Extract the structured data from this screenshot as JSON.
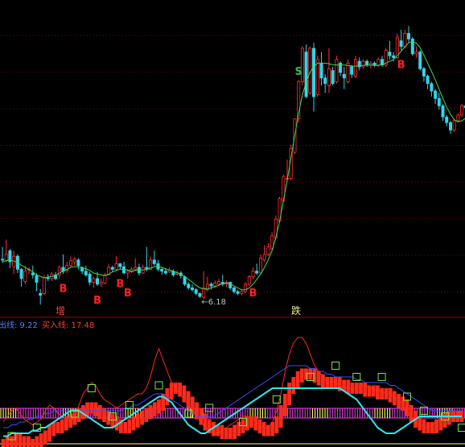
{
  "colors": {
    "background": "#000000",
    "grid": "#8b0000",
    "separator": "#b00000",
    "up_candle": "#ff3030",
    "down_candle": "#32d4e8",
    "ma_line": "#3cdc50",
    "signal_buy": "#ff2020",
    "signal_sell": "#2ec050",
    "low_label": "#c0c0c0",
    "indicator_red": "#ff2a1a",
    "indicator_cyan": "#2ee6ee",
    "indicator_blue": "#3a50ff",
    "indicator_square": "#7ee04a",
    "band_yellow": "#ffff66",
    "band_magenta": "#e040e0",
    "legend_blue": "#5a7cff",
    "legend_red": "#ff3a3a",
    "tag_zeng": "#ff4040",
    "tag_die": "#e8e8a0"
  },
  "price_panel": {
    "low_marker_text": "←6.18",
    "buy_signal_label": "B",
    "sell_signal_label": "S",
    "tag_left": "增",
    "tag_right": "跌"
  },
  "indicator_panel": {
    "legend_sell_text": "出线: 9.22",
    "legend_buy_text": "买入线: 17.48"
  },
  "chart_data": {
    "type": "candlestick",
    "ohlc": [
      [
        7.22,
        7.2,
        7.55,
        7.12
      ],
      [
        7.18,
        7.35,
        7.75,
        7.15
      ],
      [
        7.45,
        7.15,
        7.5,
        6.98
      ],
      [
        7.02,
        7.3,
        7.45,
        6.82
      ],
      [
        7.3,
        6.95,
        7.35,
        6.85
      ],
      [
        6.95,
        6.7,
        6.98,
        6.48
      ],
      [
        6.62,
        6.9,
        7.05,
        6.55
      ],
      [
        6.95,
        6.95,
        7.0,
        6.82
      ],
      [
        6.85,
        6.8,
        7.05,
        6.7
      ],
      [
        6.78,
        6.6,
        6.84,
        6.36
      ],
      [
        6.3,
        6.25,
        6.42,
        6.0
      ],
      [
        6.3,
        6.72,
        6.8,
        6.25
      ],
      [
        6.72,
        6.7,
        6.82,
        6.63
      ],
      [
        6.7,
        6.82,
        6.88,
        6.63
      ],
      [
        6.8,
        6.7,
        6.88,
        6.66
      ],
      [
        6.8,
        7.0,
        7.05,
        6.7
      ],
      [
        7.0,
        6.9,
        7.35,
        6.82
      ],
      [
        6.92,
        7.05,
        7.15,
        6.85
      ],
      [
        7.05,
        7.18,
        7.3,
        7.0
      ],
      [
        7.15,
        7.22,
        7.28,
        7.05
      ],
      [
        7.2,
        7.05,
        7.25,
        6.95
      ],
      [
        7.0,
        6.9,
        7.02,
        6.82
      ],
      [
        6.9,
        6.8,
        7.05,
        6.75
      ],
      [
        6.82,
        6.6,
        6.88,
        6.52
      ],
      [
        6.6,
        6.7,
        6.75,
        6.45
      ],
      [
        6.7,
        6.55,
        6.88,
        6.5
      ],
      [
        6.55,
        6.6,
        6.7,
        6.48
      ],
      [
        6.58,
        6.8,
        6.85,
        6.55
      ],
      [
        6.8,
        7.0,
        7.1,
        6.78
      ],
      [
        7.0,
        6.95,
        7.05,
        6.88
      ],
      [
        6.95,
        7.1,
        7.3,
        6.9
      ],
      [
        7.1,
        7.02,
        7.12,
        6.95
      ],
      [
        7.02,
        6.85,
        7.15,
        6.82
      ],
      [
        6.85,
        6.9,
        6.95,
        6.7
      ],
      [
        6.88,
        6.95,
        7.0,
        6.85
      ],
      [
        6.95,
        7.0,
        7.25,
        6.92
      ],
      [
        7.0,
        6.85,
        7.1,
        6.78
      ],
      [
        6.85,
        7.0,
        7.08,
        6.82
      ],
      [
        7.0,
        6.95,
        7.55,
        6.9
      ],
      [
        6.95,
        7.2,
        7.3,
        6.92
      ],
      [
        7.2,
        7.1,
        7.45,
        7.05
      ],
      [
        7.1,
        6.95,
        7.2,
        6.9
      ],
      [
        6.95,
        6.9,
        7.0,
        6.8
      ],
      [
        6.9,
        6.85,
        6.98,
        6.8
      ],
      [
        6.88,
        6.92,
        7.0,
        6.85
      ],
      [
        6.9,
        6.8,
        6.95,
        6.75
      ],
      [
        6.82,
        6.85,
        6.92,
        6.78
      ],
      [
        6.85,
        6.78,
        6.9,
        6.7
      ],
      [
        6.75,
        6.55,
        6.78,
        6.5
      ],
      [
        6.55,
        6.45,
        6.6,
        6.4
      ],
      [
        6.45,
        6.4,
        6.55,
        6.35
      ],
      [
        6.4,
        6.3,
        6.45,
        6.25
      ],
      [
        6.3,
        6.22,
        6.32,
        6.18
      ],
      [
        6.2,
        6.45,
        6.9,
        6.15
      ],
      [
        6.4,
        6.55,
        6.75,
        6.35
      ],
      [
        6.55,
        6.5,
        6.6,
        6.4
      ],
      [
        6.5,
        6.58,
        6.65,
        6.45
      ],
      [
        6.55,
        6.62,
        6.7,
        6.5
      ],
      [
        6.6,
        6.55,
        6.8,
        6.5
      ],
      [
        6.55,
        6.6,
        6.65,
        6.48
      ],
      [
        6.6,
        6.45,
        6.62,
        6.4
      ],
      [
        6.45,
        6.35,
        6.48,
        6.3
      ],
      [
        6.35,
        6.3,
        6.4,
        6.25
      ],
      [
        6.3,
        6.35,
        6.4,
        6.25
      ],
      [
        6.35,
        6.55,
        6.6,
        6.3
      ],
      [
        6.55,
        6.75,
        6.8,
        6.5
      ],
      [
        6.75,
        6.9,
        7.0,
        6.7
      ],
      [
        6.9,
        6.85,
        7.1,
        6.8
      ],
      [
        6.85,
        7.25,
        7.35,
        6.82
      ],
      [
        7.2,
        7.35,
        7.6,
        7.15
      ],
      [
        7.35,
        7.55,
        7.65,
        7.3
      ],
      [
        7.5,
        7.85,
        7.95,
        7.45
      ],
      [
        7.8,
        8.3,
        8.4,
        7.75
      ],
      [
        8.25,
        8.85,
        8.9,
        8.2
      ],
      [
        8.8,
        9.45,
        9.5,
        8.75
      ],
      [
        9.4,
        9.4,
        9.9,
        9.3
      ],
      [
        9.4,
        10.2,
        10.3,
        9.35
      ],
      [
        10.1,
        11.0,
        11.0,
        10.05
      ],
      [
        11.0,
        12.0,
        12.05,
        10.9
      ],
      [
        12.0,
        12.9,
        12.95,
        11.9
      ],
      [
        12.8,
        11.6,
        13.0,
        11.55
      ],
      [
        11.7,
        12.9,
        12.95,
        11.65
      ],
      [
        12.9,
        11.6,
        13.05,
        11.2
      ],
      [
        11.65,
        12.6,
        12.7,
        11.6
      ],
      [
        12.5,
        12.1,
        12.8,
        11.9
      ],
      [
        12.1,
        11.95,
        12.2,
        11.7
      ],
      [
        11.9,
        12.35,
        12.9,
        11.7
      ],
      [
        12.3,
        11.95,
        12.4,
        11.9
      ],
      [
        12.0,
        12.6,
        12.7,
        11.95
      ],
      [
        12.5,
        12.25,
        12.55,
        12.15
      ],
      [
        12.2,
        12.1,
        12.4,
        11.8
      ],
      [
        12.0,
        12.5,
        12.6,
        11.95
      ],
      [
        12.4,
        12.2,
        12.45,
        12.1
      ],
      [
        12.15,
        12.6,
        12.7,
        12.1
      ],
      [
        12.55,
        12.4,
        12.65,
        12.3
      ],
      [
        12.4,
        12.55,
        12.6,
        12.35
      ],
      [
        12.55,
        12.45,
        12.6,
        12.4
      ],
      [
        12.45,
        12.5,
        12.55,
        12.35
      ],
      [
        12.5,
        12.45,
        12.55,
        12.4
      ],
      [
        12.45,
        12.6,
        12.65,
        12.4
      ],
      [
        12.6,
        12.45,
        12.7,
        12.4
      ],
      [
        12.45,
        12.85,
        12.9,
        12.4
      ],
      [
        12.8,
        12.7,
        13.1,
        12.6
      ],
      [
        12.7,
        12.65,
        12.8,
        12.55
      ],
      [
        12.65,
        13.2,
        13.3,
        12.6
      ],
      [
        13.1,
        12.95,
        13.4,
        12.85
      ],
      [
        12.95,
        13.3,
        13.4,
        12.9
      ],
      [
        13.3,
        13.15,
        13.5,
        13.05
      ],
      [
        13.15,
        12.75,
        13.2,
        12.7
      ],
      [
        12.75,
        12.8,
        12.95,
        12.65
      ],
      [
        12.8,
        12.35,
        12.85,
        12.3
      ],
      [
        12.35,
        12.15,
        12.4,
        12.0
      ],
      [
        12.15,
        11.95,
        12.2,
        11.8
      ],
      [
        11.95,
        11.75,
        12.0,
        11.6
      ],
      [
        11.75,
        11.55,
        11.8,
        11.4
      ],
      [
        11.55,
        11.35,
        11.7,
        11.25
      ],
      [
        11.35,
        11.05,
        11.4,
        10.95
      ],
      [
        11.05,
        10.9,
        11.1,
        10.8
      ],
      [
        10.9,
        10.7,
        10.95,
        10.6
      ],
      [
        10.7,
        10.95,
        11.0,
        10.65
      ],
      [
        10.95,
        11.1,
        11.15,
        10.9
      ],
      [
        11.1,
        11.35,
        11.4,
        11.05
      ],
      [
        11.35,
        11.3,
        11.45,
        11.25
      ],
      [
        11.3,
        11.45,
        11.55,
        11.25
      ]
    ],
    "ma": [
      7.15,
      7.18,
      7.2,
      7.17,
      7.14,
      7.06,
      7.0,
      6.94,
      6.88,
      6.8,
      6.76,
      6.72,
      6.74,
      6.76,
      6.78,
      6.85,
      6.9,
      6.95,
      7.0,
      7.02,
      7.02,
      7.0,
      6.96,
      6.92,
      6.85,
      6.82,
      6.8,
      6.78,
      6.82,
      6.88,
      6.92,
      6.95,
      6.95,
      6.93,
      6.9,
      6.92,
      6.94,
      6.93,
      6.95,
      6.98,
      7.02,
      7.03,
      7.0,
      6.96,
      6.93,
      6.9,
      6.86,
      6.82,
      6.75,
      6.68,
      6.6,
      6.52,
      6.45,
      6.42,
      6.42,
      6.45,
      6.48,
      6.52,
      6.56,
      6.58,
      6.56,
      6.5,
      6.45,
      6.4,
      6.4,
      6.45,
      6.55,
      6.68,
      6.82,
      7.0,
      7.2,
      7.45,
      7.8,
      8.25,
      8.8,
      9.35,
      9.95,
      10.55,
      11.15,
      11.65,
      12.0,
      12.25,
      12.4,
      12.5,
      12.5,
      12.5,
      12.48,
      12.46,
      12.45,
      12.45,
      12.45,
      12.44,
      12.42,
      12.42,
      12.43,
      12.44,
      12.45,
      12.45,
      12.44,
      12.44,
      12.46,
      12.5,
      12.55,
      12.6,
      12.7,
      12.82,
      12.94,
      13.05,
      13.08,
      13.04,
      12.92,
      12.72,
      12.5,
      12.28,
      12.05,
      11.8,
      11.55,
      11.32,
      11.12,
      10.98,
      10.92,
      10.95,
      11.02,
      11.12
    ],
    "buy_signals": [
      16,
      25,
      31,
      33,
      66,
      105
    ],
    "sell_signals": [
      78
    ],
    "low_marker_index": 52,
    "indicator": {
      "sell_line": 9.22,
      "buy_line": 17.48,
      "ylim": [
        0,
        40
      ],
      "red_thin": [
        8,
        10,
        12,
        13,
        11,
        9,
        8,
        7,
        8,
        9,
        12,
        14,
        13,
        11,
        10,
        9,
        8,
        10,
        14,
        18,
        20,
        22,
        21,
        18,
        16,
        15,
        14,
        13,
        14,
        15,
        16,
        17,
        18,
        18,
        20,
        24,
        30,
        34,
        30,
        26,
        22,
        20,
        18,
        16,
        14,
        12,
        10,
        8,
        6,
        5,
        4,
        4,
        5,
        6,
        7,
        8,
        9,
        10,
        10,
        9,
        8,
        7,
        6,
        6,
        8,
        12,
        18,
        26,
        32,
        36,
        38,
        38,
        36,
        32,
        28,
        26,
        24,
        22,
        22,
        22,
        21,
        20,
        20,
        20,
        20,
        21,
        21,
        20,
        20,
        19,
        19,
        18,
        18,
        17,
        16,
        14,
        12,
        10,
        8,
        7,
        6,
        6,
        7,
        8,
        9,
        10,
        11,
        11,
        10,
        9
      ],
      "red_bars": [
        2,
        3,
        3,
        4,
        3,
        3,
        2,
        2,
        3,
        4,
        5,
        7,
        8,
        8,
        9,
        10,
        11,
        12,
        13,
        14,
        15,
        15,
        14,
        13,
        12,
        11,
        10,
        9,
        8,
        8,
        9,
        10,
        11,
        12,
        13,
        14,
        15,
        16,
        18,
        20,
        22,
        22,
        21,
        19,
        17,
        15,
        13,
        11,
        9,
        8,
        7,
        7,
        6,
        6,
        6,
        7,
        8,
        9,
        10,
        10,
        9,
        8,
        7,
        7,
        8,
        10,
        14,
        18,
        22,
        24,
        26,
        27,
        27,
        27,
        26,
        25,
        24,
        24,
        24,
        24,
        23,
        23,
        22,
        22,
        22,
        22,
        21,
        21,
        21,
        20,
        20,
        20,
        19,
        18,
        17,
        16,
        14,
        12,
        10,
        9,
        8,
        8,
        8,
        9,
        10,
        11,
        12,
        12,
        12,
        12
      ],
      "cyan": [
        3,
        3,
        4,
        4,
        4,
        4,
        4,
        5,
        5,
        6,
        6,
        7,
        8,
        9,
        10,
        11,
        12,
        12,
        12,
        11,
        10,
        9,
        8,
        7,
        6,
        6,
        6,
        7,
        8,
        9,
        10,
        11,
        12,
        13,
        14,
        15,
        16,
        17,
        17,
        16,
        15,
        13,
        11,
        9,
        7,
        6,
        5,
        4,
        4,
        5,
        6,
        7,
        8,
        9,
        10,
        11,
        12,
        13,
        14,
        15,
        16,
        17,
        18,
        19,
        20,
        20,
        20,
        20,
        20,
        20,
        20,
        20,
        20,
        20,
        20,
        20,
        20,
        20,
        20,
        20,
        20,
        19,
        18,
        17,
        16,
        14,
        12,
        10,
        8,
        6,
        5,
        4,
        4,
        4,
        5,
        6,
        7,
        8,
        9,
        10,
        10,
        10,
        10,
        10,
        10,
        10,
        10,
        10,
        10,
        10
      ],
      "blue": [
        6,
        6,
        7,
        7,
        8,
        8,
        9,
        9,
        10,
        10,
        11,
        11,
        12,
        12,
        12,
        12,
        12,
        12,
        12,
        12,
        12,
        12,
        12,
        12,
        12,
        12,
        12,
        12,
        12,
        13,
        13,
        14,
        14,
        15,
        16,
        17,
        18,
        18,
        18,
        17,
        16,
        15,
        14,
        13,
        12,
        11,
        10,
        10,
        10,
        10,
        10,
        11,
        12,
        13,
        14,
        15,
        16,
        17,
        18,
        19,
        20,
        21,
        22,
        23,
        24,
        25,
        26,
        27,
        28,
        28,
        28,
        28,
        28,
        27,
        27,
        26,
        26,
        25,
        25,
        24,
        24,
        24,
        24,
        24,
        23,
        23,
        22,
        22,
        22,
        22,
        22,
        22,
        21,
        21,
        20,
        19,
        18,
        17,
        16,
        15,
        14,
        13,
        12,
        12,
        12,
        12,
        12,
        12,
        12,
        12
      ],
      "squares": [
        [
          2,
          3
        ],
        [
          8,
          6
        ],
        [
          17,
          11
        ],
        [
          21,
          20
        ],
        [
          26,
          10
        ],
        [
          30,
          14
        ],
        [
          37,
          21
        ],
        [
          44,
          11
        ],
        [
          49,
          13
        ],
        [
          57,
          8
        ],
        [
          65,
          16
        ],
        [
          73,
          24
        ],
        [
          79,
          28
        ],
        [
          84,
          24
        ],
        [
          90,
          24
        ],
        [
          96,
          17
        ],
        [
          100,
          12
        ],
        [
          105,
          10
        ],
        [
          109,
          6
        ],
        [
          114,
          8
        ]
      ]
    }
  }
}
